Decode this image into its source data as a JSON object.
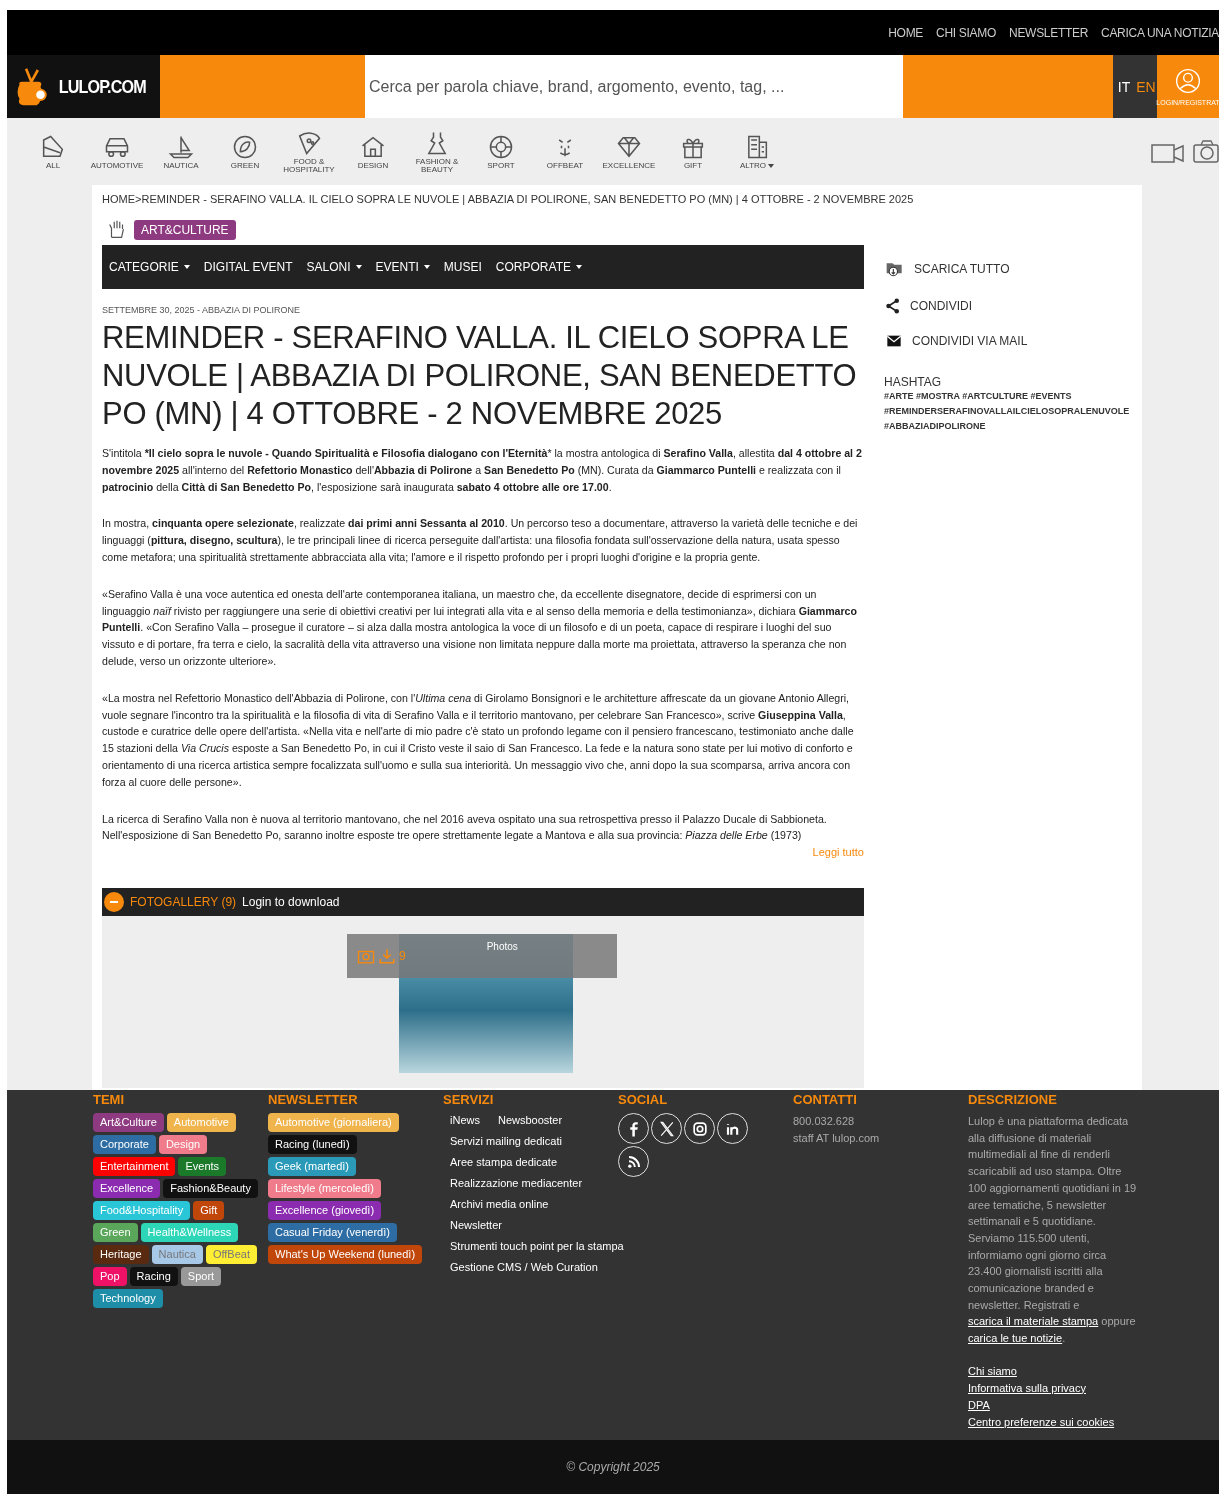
{
  "top_nav": [
    "HOME",
    "CHI SIAMO",
    "NEWSLETTER",
    "CARICA UNA NOTIZIA"
  ],
  "header": {
    "logo": "LULOP.COM",
    "search": {
      "placeholder": "Cerca per parola chiave, brand, argomento, evento, tag, ..."
    },
    "languages": [
      {
        "label": "IT",
        "selected": true
      },
      {
        "label": "EN",
        "selected": false
      }
    ],
    "login": "LOGIN/REGISTRAT"
  },
  "categories": [
    {
      "label": "ALL"
    },
    {
      "label": "AUTOMOTIVE"
    },
    {
      "label": "NAUTICA"
    },
    {
      "label": "GREEN"
    },
    {
      "label": "FOOD & HOSPITALITY"
    },
    {
      "label": "DESIGN"
    },
    {
      "label": "FASHION & BEAUTY"
    },
    {
      "label": "SPORT"
    },
    {
      "label": "OFFBEAT"
    },
    {
      "label": "EXCELLENCE"
    },
    {
      "label": "GIFT"
    },
    {
      "label": "ALTRO",
      "dropdown": true
    }
  ],
  "breadcrumb": {
    "items": [
      "HOME",
      "REMINDER - SERAFINO VALLA. IL CIELO SOPRA LE NUVOLE | ABBAZIA DI POLIRONE, SAN BENEDETTO PO (MN) | 4 OTTOBRE - 2 NOVEMBRE 2025"
    ],
    "separator": ">"
  },
  "section_badge": "ART&CULTURE",
  "menu": [
    {
      "label": "CATEGORIE",
      "dropdown": true
    },
    {
      "label": "DIGITAL EVENT",
      "dropdown": false
    },
    {
      "label": "SALONI",
      "dropdown": true
    },
    {
      "label": "EVENTI",
      "dropdown": true
    },
    {
      "label": "MUSEI",
      "dropdown": false
    },
    {
      "label": "CORPORATE",
      "dropdown": true
    }
  ],
  "article": {
    "meta": "SETTEMBRE 30, 2025 - ABBAZIA DI POLIRONE",
    "title": "REMINDER - SERAFINO VALLA. IL CIELO SOPRA LE NUVOLE | ABBAZIA DI POLIRONE, SAN BENEDETTO PO (MN) | 4 OTTOBRE - 2 NOVEMBRE 2025",
    "paragraphs": [
      "S'intitola ***Il cielo sopra le nuvole - Quando Spiritualità e Filosofia dialogano con l'Eternità*** la mostra antologica di **Serafino Valla**, allestita **dal 4 ottobre al 2 novembre 2025** all'interno del **Refettorio Monastico** dell'**Abbazia di Polirone** a **San Benedetto Po** (MN). Curata da **Giammarco Puntelli** e realizzata con il **patrocinio** della **Città di San Benedetto Po**, l'esposizione sarà inaugurata **sabato 4 ottobre alle ore 17.00**.",
      "In mostra, **cinquanta opere selezionate**, realizzate **dai primi anni Sessanta al 2010**. Un percorso teso a documentare, attraverso la varietà delle tecniche e dei linguaggi (**pittura, disegno, scultura**), le tre principali linee di ricerca perseguite dall'artista: una filosofia fondata sull'osservazione della natura, usata spesso come metafora; una spiritualità strettamente abbracciata alla vita; l'amore e il rispetto profondo per i propri luoghi d'origine e la propria gente.",
      "«Serafino Valla è una voce autentica ed onesta dell'arte contemporanea italiana, un maestro che, da eccellente disegnatore, decide di esprimersi con un linguaggio *naïf* rivisto per raggiungere una serie di obiettivi creativi per lui integrati alla vita e al senso della memoria e della testimonianza», dichiara **Giammarco Puntelli**. «Con Serafino Valla – prosegue il curatore – si alza dalla mostra antologica la voce di un filosofo e di un poeta, capace di respirare i luoghi del suo vissuto e di portare, fra terra e cielo, la sacralità della vita attraverso una visione non limitata neppure dalla morte ma proiettata, attraverso la speranza che non delude, verso un orizzonte ulteriore».",
      "«La mostra nel Refettorio Monastico dell'Abbazia di Polirone, con l'*Ultima cena* di Girolamo Bonsignori e le architetture affrescate da un giovane Antonio Allegri, vuole segnare l'incontro tra la spiritualità e la filosofia di vita di Serafino Valla e il territorio mantovano, per celebrare San Francesco», scrive **Giuseppina Valla**, custode e curatrice delle opere dell'artista. «Nella vita e nell'arte di mio padre c'è stato un profondo legame con il pensiero francescano, testimoniato anche dalle 15 stazioni della *Via Crucis* esposte a San Benedetto Po, in cui il Cristo veste il saio di San Francesco. La fede e la natura sono state per lui motivo di conforto e orientamento di una ricerca artistica sempre focalizzata sull'uomo e sulla sua interiorità. Un messaggio vivo che, anni dopo la sua scomparsa, arriva ancora con forza al cuore delle persone».",
      "La ricerca di Serafino Valla non è nuova al territorio mantovano, che nel 2016 aveva ospitato una sua retrospettiva presso il Palazzo Ducale di Sabbioneta. Nell'esposizione di San Benedetto Po, saranno inoltre esposte tre opere strettamente legate a Mantova e alla sua provincia: *Piazza delle Erbe* (1973)"
    ],
    "read_more": "Leggi tutto"
  },
  "sidebar": {
    "actions": [
      {
        "kind": "download",
        "label": "SCARICA TUTTO"
      },
      {
        "kind": "share",
        "label": "CONDIVIDI"
      },
      {
        "kind": "mail",
        "label": "CONDIVIDI VIA MAIL"
      }
    ],
    "hashtag_title": "HASHTAG",
    "hashtags": [
      "#ARTE #MOSTRA #ARTCULTURE #EVENTS",
      "#REMINDERSERAFINOVALLAILCIELOSOPRALENUVOLE",
      "#ABBAZIADIPOLIRONE"
    ]
  },
  "gallery": {
    "title": "FOTOGALLERY",
    "count": "(9)",
    "login": "Login to download",
    "photo_count": "9",
    "photos_label": "Photos"
  },
  "footer": {
    "temi": {
      "title": "TEMI",
      "tags": [
        {
          "label": "Art&Culture",
          "color": "#8e3a80"
        },
        {
          "label": "Automotive",
          "color": "#f0b44c"
        },
        {
          "label": "Corporate",
          "color": "#2e6da4"
        },
        {
          "label": "Design",
          "color": "#f07b8a"
        },
        {
          "label": "Entertainment",
          "color": "#ff0000"
        },
        {
          "label": "Events",
          "color": "#1a7a2a"
        },
        {
          "label": "Excellence",
          "color": "#8a2bb0"
        },
        {
          "label": "Fashion&Beauty",
          "color": "#111111"
        },
        {
          "label": "Food&Hospitality",
          "color": "#29c6d8"
        },
        {
          "label": "Gift",
          "color": "#c0460a"
        },
        {
          "label": "Green",
          "color": "#5aa65a"
        },
        {
          "label": "Health&Wellness",
          "color": "#2ed6b8"
        },
        {
          "label": "Heritage",
          "color": "#5a2a10"
        },
        {
          "label": "Nautica",
          "color": "#a8c8e8"
        },
        {
          "label": "OffBeat",
          "color": "#ffee33"
        },
        {
          "label": "Pop",
          "color": "#ee1166"
        },
        {
          "label": "Racing",
          "color": "#111111"
        },
        {
          "label": "Sport",
          "color": "#999999"
        },
        {
          "label": "Technology",
          "color": "#1e8ea8"
        }
      ]
    },
    "newsletter": {
      "title": "NEWSLETTER",
      "tags": [
        {
          "label": "Automotive (giornaliera)",
          "color": "#f0b44c"
        },
        {
          "label": "Racing (lunedì)",
          "color": "#111111"
        },
        {
          "label": "Geek (martedì)",
          "color": "#2a9ab8"
        },
        {
          "label": "Lifestyle (mercoledì)",
          "color": "#f07b8a"
        },
        {
          "label": "Excellence (giovedì)",
          "color": "#8a2bb0"
        },
        {
          "label": "Casual Friday (venerdì)",
          "color": "#2e6da4"
        },
        {
          "label": "What's Up Weekend (lunedì)",
          "color": "#c0460a"
        }
      ]
    },
    "servizi": {
      "title": "SERVIZI",
      "rows": [
        [
          "iNews",
          "Newsbooster"
        ],
        [
          "Servizi mailing dedicati"
        ],
        [
          "Aree stampa dedicate"
        ],
        [
          "Realizzazione mediacenter"
        ],
        [
          "Archivi media online"
        ],
        [
          "Newsletter"
        ],
        [
          "Strumenti touch point per la stampa"
        ],
        [
          "Gestione CMS / Web Curation"
        ]
      ]
    },
    "social": {
      "title": "SOCIAL"
    },
    "contatti": {
      "title": "CONTATTI",
      "lines": [
        "800.032.628",
        "staff AT lulop.com"
      ]
    },
    "descrizione": {
      "title": "DESCRIZIONE",
      "segments": [
        {
          "text": "Lulop è una piattaforma dedicata alla diffusione di materiali multimediali al fine di renderli scaricabili ad uso stampa. Oltre 100 aggiornamenti quotidiani in 19 aree tematiche, 5 newsletter settimanali e 5 quotidiane. Serviamo 115.500 utenti, informiamo ogni giorno circa 23.400 giornalisti iscritti alla comunicazione branded e newsletter. Registrati e",
          "link": false
        },
        {
          "text": "scarica il materiale stampa",
          "link": true
        },
        {
          "text": "oppure",
          "link": false
        },
        {
          "text": "carica le tue notizie",
          "link": true
        },
        {
          "text": ".",
          "link": false
        }
      ],
      "links": [
        "Chi siamo",
        "Informativa sulla privacy",
        "DPA",
        "Centro preferenze sui cookies"
      ]
    }
  },
  "copyright": "© Copyright 2025"
}
